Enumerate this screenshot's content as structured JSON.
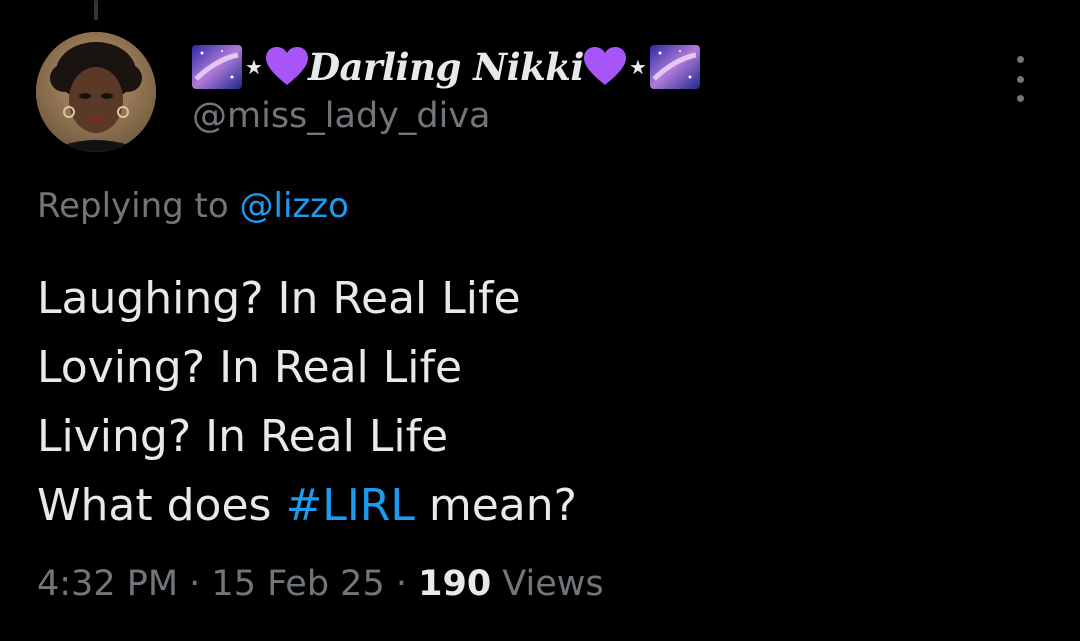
{
  "tweet": {
    "display_name": "Darling Nikki",
    "star_glyph": "★",
    "handle": "@miss_lady_diva",
    "reply_prefix": "Replying to",
    "reply_mention": "@lizzo",
    "lines": [
      "Laughing? In Real Life",
      "Loving? In Real Life",
      "Living? In Real Life"
    ],
    "last_line_before": "What does ",
    "hashtag": "#LIRL",
    "last_line_after": " mean?",
    "time": "4:32 PM",
    "separator": " · ",
    "date": "15 Feb 25",
    "views_count": "190",
    "views_label": " Views"
  },
  "icons": {
    "avatar": "profile-photo",
    "name_decoration": [
      "galaxy-emoji",
      "star",
      "purple-heart-emoji"
    ],
    "more": "more-options-icon"
  },
  "colors": {
    "background": "#000000",
    "primary_text": "#e7e9ea",
    "secondary_text": "#71767b",
    "link": "#1d9bf0",
    "heart": "#a855f7"
  }
}
